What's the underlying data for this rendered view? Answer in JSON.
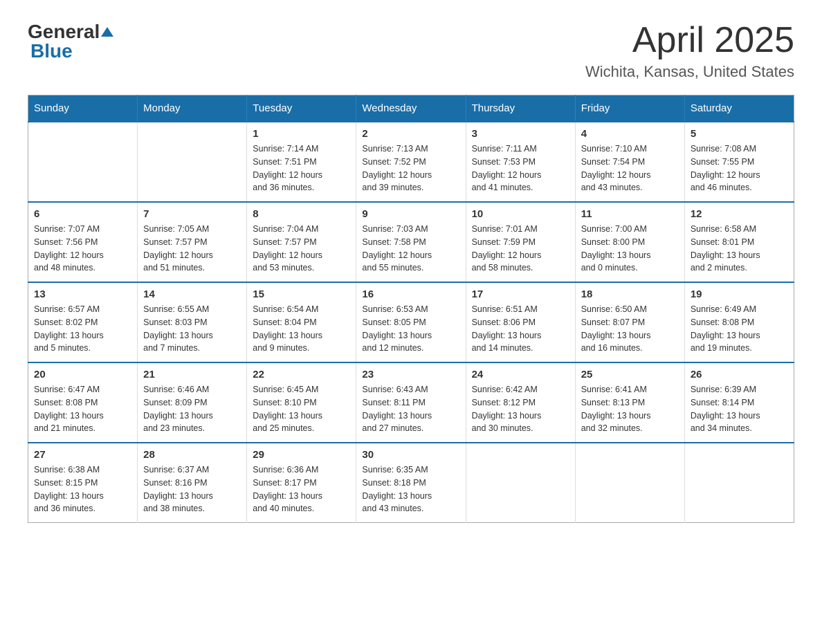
{
  "logo": {
    "text_general": "General",
    "text_blue": "Blue"
  },
  "title": "April 2025",
  "subtitle": "Wichita, Kansas, United States",
  "days_of_week": [
    "Sunday",
    "Monday",
    "Tuesday",
    "Wednesday",
    "Thursday",
    "Friday",
    "Saturday"
  ],
  "weeks": [
    [
      {
        "day": "",
        "info": ""
      },
      {
        "day": "",
        "info": ""
      },
      {
        "day": "1",
        "info": "Sunrise: 7:14 AM\nSunset: 7:51 PM\nDaylight: 12 hours\nand 36 minutes."
      },
      {
        "day": "2",
        "info": "Sunrise: 7:13 AM\nSunset: 7:52 PM\nDaylight: 12 hours\nand 39 minutes."
      },
      {
        "day": "3",
        "info": "Sunrise: 7:11 AM\nSunset: 7:53 PM\nDaylight: 12 hours\nand 41 minutes."
      },
      {
        "day": "4",
        "info": "Sunrise: 7:10 AM\nSunset: 7:54 PM\nDaylight: 12 hours\nand 43 minutes."
      },
      {
        "day": "5",
        "info": "Sunrise: 7:08 AM\nSunset: 7:55 PM\nDaylight: 12 hours\nand 46 minutes."
      }
    ],
    [
      {
        "day": "6",
        "info": "Sunrise: 7:07 AM\nSunset: 7:56 PM\nDaylight: 12 hours\nand 48 minutes."
      },
      {
        "day": "7",
        "info": "Sunrise: 7:05 AM\nSunset: 7:57 PM\nDaylight: 12 hours\nand 51 minutes."
      },
      {
        "day": "8",
        "info": "Sunrise: 7:04 AM\nSunset: 7:57 PM\nDaylight: 12 hours\nand 53 minutes."
      },
      {
        "day": "9",
        "info": "Sunrise: 7:03 AM\nSunset: 7:58 PM\nDaylight: 12 hours\nand 55 minutes."
      },
      {
        "day": "10",
        "info": "Sunrise: 7:01 AM\nSunset: 7:59 PM\nDaylight: 12 hours\nand 58 minutes."
      },
      {
        "day": "11",
        "info": "Sunrise: 7:00 AM\nSunset: 8:00 PM\nDaylight: 13 hours\nand 0 minutes."
      },
      {
        "day": "12",
        "info": "Sunrise: 6:58 AM\nSunset: 8:01 PM\nDaylight: 13 hours\nand 2 minutes."
      }
    ],
    [
      {
        "day": "13",
        "info": "Sunrise: 6:57 AM\nSunset: 8:02 PM\nDaylight: 13 hours\nand 5 minutes."
      },
      {
        "day": "14",
        "info": "Sunrise: 6:55 AM\nSunset: 8:03 PM\nDaylight: 13 hours\nand 7 minutes."
      },
      {
        "day": "15",
        "info": "Sunrise: 6:54 AM\nSunset: 8:04 PM\nDaylight: 13 hours\nand 9 minutes."
      },
      {
        "day": "16",
        "info": "Sunrise: 6:53 AM\nSunset: 8:05 PM\nDaylight: 13 hours\nand 12 minutes."
      },
      {
        "day": "17",
        "info": "Sunrise: 6:51 AM\nSunset: 8:06 PM\nDaylight: 13 hours\nand 14 minutes."
      },
      {
        "day": "18",
        "info": "Sunrise: 6:50 AM\nSunset: 8:07 PM\nDaylight: 13 hours\nand 16 minutes."
      },
      {
        "day": "19",
        "info": "Sunrise: 6:49 AM\nSunset: 8:08 PM\nDaylight: 13 hours\nand 19 minutes."
      }
    ],
    [
      {
        "day": "20",
        "info": "Sunrise: 6:47 AM\nSunset: 8:08 PM\nDaylight: 13 hours\nand 21 minutes."
      },
      {
        "day": "21",
        "info": "Sunrise: 6:46 AM\nSunset: 8:09 PM\nDaylight: 13 hours\nand 23 minutes."
      },
      {
        "day": "22",
        "info": "Sunrise: 6:45 AM\nSunset: 8:10 PM\nDaylight: 13 hours\nand 25 minutes."
      },
      {
        "day": "23",
        "info": "Sunrise: 6:43 AM\nSunset: 8:11 PM\nDaylight: 13 hours\nand 27 minutes."
      },
      {
        "day": "24",
        "info": "Sunrise: 6:42 AM\nSunset: 8:12 PM\nDaylight: 13 hours\nand 30 minutes."
      },
      {
        "day": "25",
        "info": "Sunrise: 6:41 AM\nSunset: 8:13 PM\nDaylight: 13 hours\nand 32 minutes."
      },
      {
        "day": "26",
        "info": "Sunrise: 6:39 AM\nSunset: 8:14 PM\nDaylight: 13 hours\nand 34 minutes."
      }
    ],
    [
      {
        "day": "27",
        "info": "Sunrise: 6:38 AM\nSunset: 8:15 PM\nDaylight: 13 hours\nand 36 minutes."
      },
      {
        "day": "28",
        "info": "Sunrise: 6:37 AM\nSunset: 8:16 PM\nDaylight: 13 hours\nand 38 minutes."
      },
      {
        "day": "29",
        "info": "Sunrise: 6:36 AM\nSunset: 8:17 PM\nDaylight: 13 hours\nand 40 minutes."
      },
      {
        "day": "30",
        "info": "Sunrise: 6:35 AM\nSunset: 8:18 PM\nDaylight: 13 hours\nand 43 minutes."
      },
      {
        "day": "",
        "info": ""
      },
      {
        "day": "",
        "info": ""
      },
      {
        "day": "",
        "info": ""
      }
    ]
  ]
}
